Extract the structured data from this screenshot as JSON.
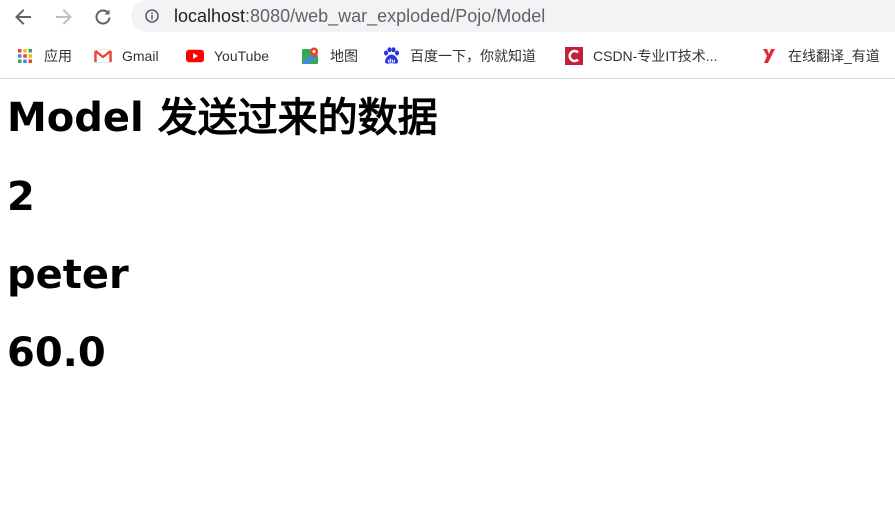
{
  "browser": {
    "url_host": "localhost",
    "url_path": ":8080/web_war_exploded/Pojo/Model",
    "nav": {
      "back_icon": "arrow-left-icon",
      "forward_icon": "arrow-right-icon",
      "reload_icon": "reload-icon",
      "info_icon": "info-circle-icon"
    }
  },
  "bookmarks": [
    {
      "label": "应用",
      "icon": "apps-grid-icon"
    },
    {
      "label": "Gmail",
      "icon": "gmail-icon"
    },
    {
      "label": "YouTube",
      "icon": "youtube-icon"
    },
    {
      "label": "地图",
      "icon": "maps-icon"
    },
    {
      "label": "百度一下，你就知道",
      "icon": "baidu-paw-icon"
    },
    {
      "label": "CSDN-专业IT技术...",
      "icon": "csdn-icon"
    },
    {
      "label": "在线翻译_有道",
      "icon": "youdao-icon"
    }
  ],
  "page": {
    "heading": "Model 发送过来的数据",
    "id_value": "2",
    "name_value": "peter",
    "score_value": "60.0"
  },
  "colors": {
    "omnibox_bg": "#f1f3f4",
    "youtube_red": "#ff0000",
    "csdn_red": "#c32136",
    "youdao_red": "#e3283a"
  }
}
